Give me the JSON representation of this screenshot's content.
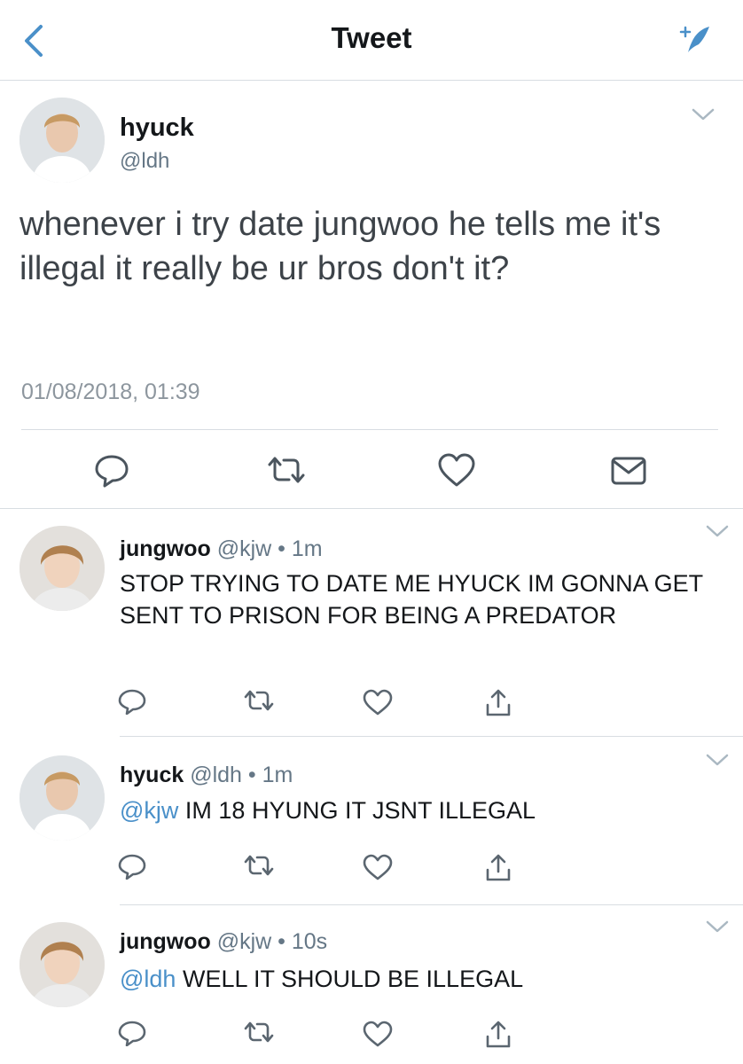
{
  "header": {
    "title": "Tweet",
    "back_icon": "chevron-left-icon",
    "compose_icon": "compose-tweet-icon",
    "accent": "#4a90c9"
  },
  "main_tweet": {
    "name": "hyuck",
    "handle": "@ldh",
    "text": "whenever i try date jungwoo he tells me it's illegal it really be ur bros don't it?",
    "timestamp": "01/08/2018, 01:39",
    "actions": [
      "reply-icon",
      "retweet-icon",
      "like-icon",
      "direct-message-icon"
    ]
  },
  "replies": [
    {
      "name": "jungwoo",
      "handle": "@kjw",
      "sep": "•",
      "time": "1m",
      "mention": "",
      "text": "STOP TRYING TO DATE ME HYUCK IM GONNA GET SENT TO PRISON FOR BEING A PREDATOR"
    },
    {
      "name": "hyuck",
      "handle": "@ldh",
      "sep": "•",
      "time": "1m",
      "mention": "@kjw",
      "text": "IM 18 HYUNG IT JSNT ILLEGAL"
    },
    {
      "name": "jungwoo",
      "handle": "@kjw",
      "sep": "•",
      "time": "10s",
      "mention": "@ldh",
      "text": "WELL IT SHOULD BE ILLEGAL"
    }
  ]
}
